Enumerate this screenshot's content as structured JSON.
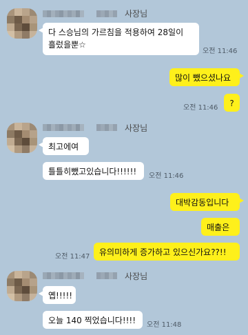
{
  "colors": {
    "background": "#b2c7d9",
    "incoming_bubble": "#ffffff",
    "outgoing_bubble": "#fef01b"
  },
  "messages": [
    {
      "text": "다 스승님의 가르침을 적용하여 28일이",
      "text2": "흘렀을뿐☆",
      "time": "오전 11:46"
    },
    {
      "text": "많이 뺐으셨나요"
    },
    {
      "text": "?",
      "time": "오전 11:46"
    },
    {
      "text": "최고에여"
    },
    {
      "text": "틀틀히뺐고있습니다!!!!!!",
      "time": "오전 11:46"
    },
    {
      "text": "대박감동입니다"
    },
    {
      "text": "매출은"
    },
    {
      "text": "유의미하게 증가하고 있으신가요??!!",
      "time": "오전 11:47"
    },
    {
      "text": "옙!!!!!"
    },
    {
      "text": "오늘 140 찍었습니다!!!!",
      "time": "오전 11:48"
    }
  ],
  "senders": [
    {
      "role": "사장님"
    },
    {
      "role": "사장님"
    },
    {
      "role": "사장님"
    }
  ]
}
